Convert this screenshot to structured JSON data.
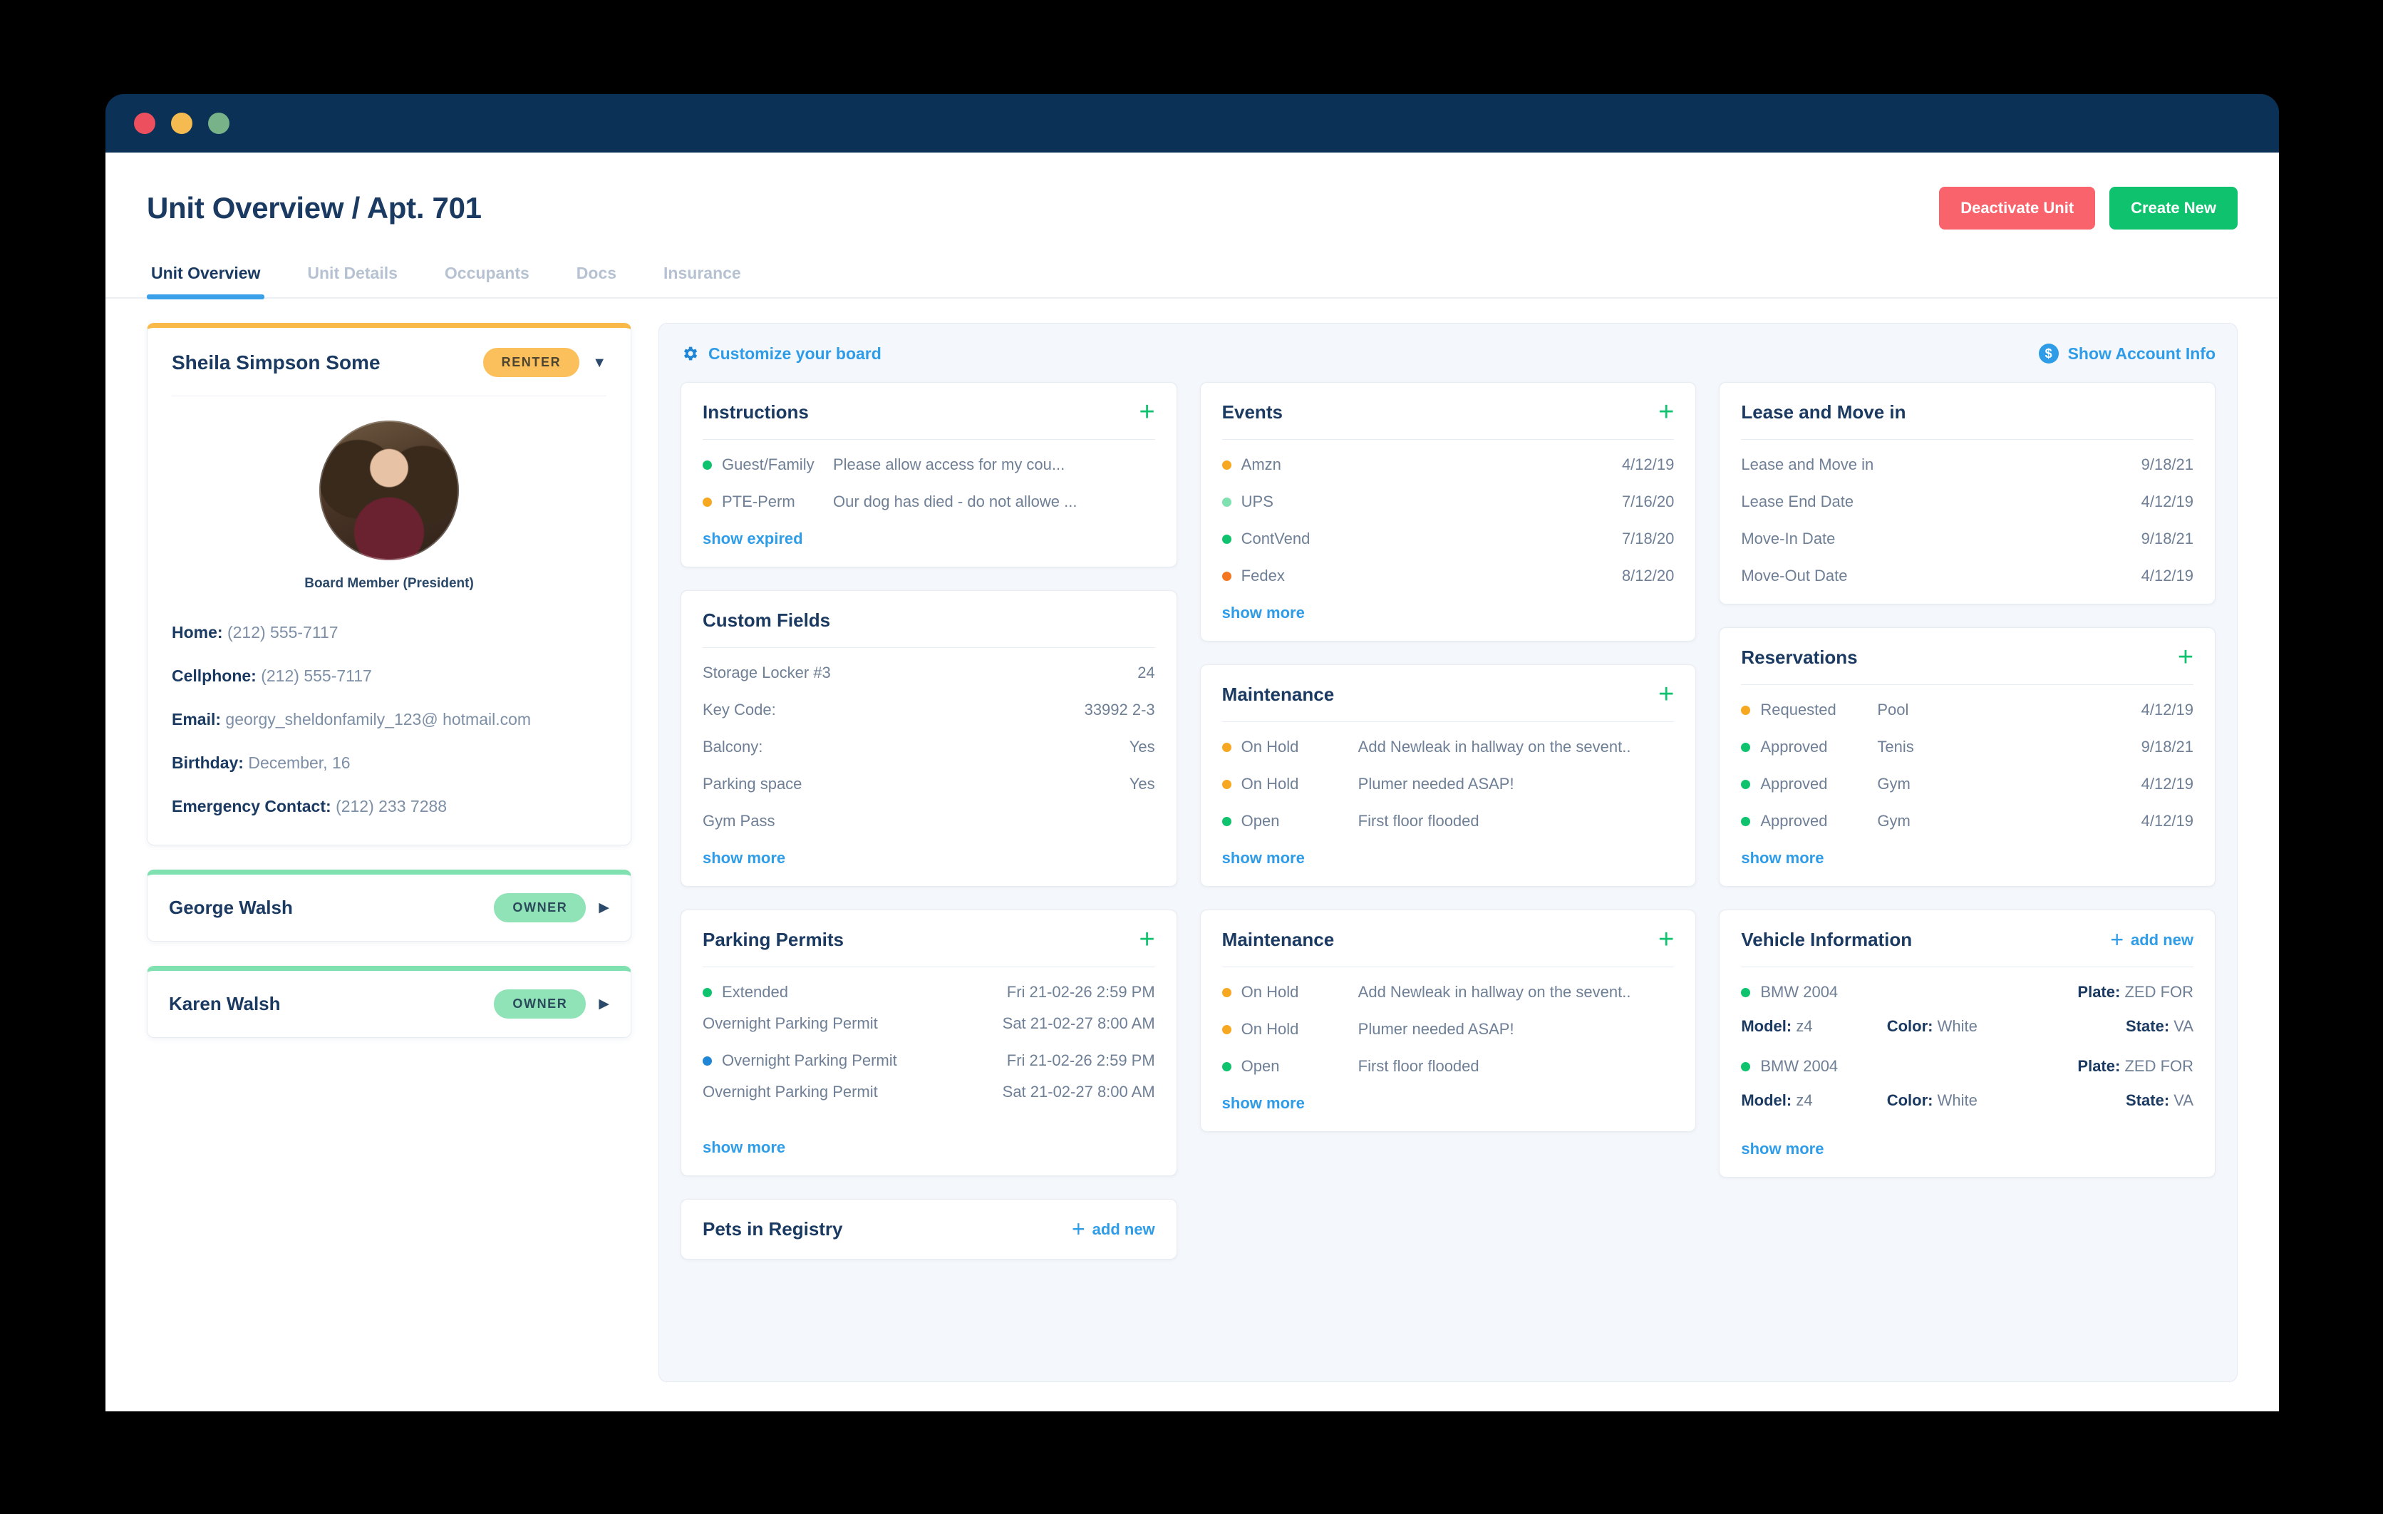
{
  "window": {
    "dots": [
      "close",
      "minimize",
      "zoom"
    ]
  },
  "header": {
    "title": "Unit Overview / Apt. 701",
    "deactivate_label": "Deactivate Unit",
    "create_label": "Create New"
  },
  "tabs": [
    {
      "label": "Unit Overview",
      "active": true
    },
    {
      "label": "Unit Details",
      "active": false
    },
    {
      "label": "Occupants",
      "active": false
    },
    {
      "label": "Docs",
      "active": false
    },
    {
      "label": "Insurance",
      "active": false
    }
  ],
  "people": [
    {
      "name": "Sheila Simpson Some",
      "badge": "RENTER",
      "role": "Board Member (President)",
      "contacts": [
        {
          "label": "Home:",
          "value": "(212) 555-7117"
        },
        {
          "label": "Cellphone:",
          "value": "(212) 555-7117"
        },
        {
          "label": "Email:",
          "value": "georgy_sheldonfamily_123@ hotmail.com"
        },
        {
          "label": "Birthday:",
          "value": "December, 16"
        },
        {
          "label": "Emergency Contact:",
          "value": "(212) 233 7288"
        }
      ]
    },
    {
      "name": "George Walsh",
      "badge": "OWNER"
    },
    {
      "name": "Karen Walsh",
      "badge": "OWNER"
    }
  ],
  "board": {
    "customize_label": "Customize your board",
    "account_info_label": "Show Account Info",
    "dollar_glyph": "$",
    "show_more_label": "show more",
    "show_expired_label": "show expired",
    "add_new_label": "add new",
    "plus_glyph": "+"
  },
  "cards": {
    "instructions": {
      "title": "Instructions",
      "rows": [
        {
          "dot": "green",
          "label": "Guest/Family",
          "desc": "Please allow access for my cou..."
        },
        {
          "dot": "orange",
          "label": "PTE-Perm",
          "desc": "Our dog has died - do not allowe ..."
        }
      ],
      "footer": "show expired"
    },
    "custom_fields": {
      "title": "Custom Fields",
      "rows": [
        {
          "label": "Storage Locker #3",
          "value": "24"
        },
        {
          "label": "Key Code:",
          "value": "33992 2-3"
        },
        {
          "label": "Balcony:",
          "value": "Yes"
        },
        {
          "label": "Parking space",
          "value": "Yes"
        },
        {
          "label": "Gym Pass",
          "value": ""
        }
      ],
      "footer": "show more"
    },
    "parking_permits": {
      "title": "Parking Permits",
      "entries": [
        {
          "dot": "green",
          "label": "Extended",
          "date": "Fri 21-02-26 2:59 PM",
          "sub_label": "Overnight Parking Permit",
          "sub_date": "Sat 21-02-27 8:00 AM"
        },
        {
          "dot": "blue",
          "label": "Overnight Parking Permit",
          "date": "Fri 21-02-26 2:59 PM",
          "sub_label": "Overnight Parking Permit",
          "sub_date": "Sat 21-02-27 8:00 AM"
        }
      ],
      "footer": "show more"
    },
    "pets": {
      "title": "Pets in Registry",
      "action": "add new"
    },
    "events": {
      "title": "Events",
      "rows": [
        {
          "dot": "orange",
          "label": "Amzn",
          "date": "4/12/19"
        },
        {
          "dot": "mint",
          "label": "UPS",
          "date": "7/16/20"
        },
        {
          "dot": "green",
          "label": "ContVend",
          "date": "7/18/20"
        },
        {
          "dot": "deepor",
          "label": "Fedex",
          "date": "8/12/20"
        }
      ],
      "footer": "show more"
    },
    "maintenance_1": {
      "title": "Maintenance",
      "rows": [
        {
          "dot": "orange",
          "label": "On Hold",
          "desc": "Add Newleak in hallway on the sevent.."
        },
        {
          "dot": "orange",
          "label": "On Hold",
          "desc": "Plumer needed ASAP!"
        },
        {
          "dot": "green",
          "label": "Open",
          "desc": "First floor flooded"
        }
      ],
      "footer": "show more"
    },
    "maintenance_2": {
      "title": "Maintenance",
      "rows": [
        {
          "dot": "orange",
          "label": "On Hold",
          "desc": "Add Newleak in hallway on the sevent.."
        },
        {
          "dot": "orange",
          "label": "On Hold",
          "desc": "Plumer needed ASAP!"
        },
        {
          "dot": "green",
          "label": "Open",
          "desc": "First floor flooded"
        }
      ],
      "footer": "show more"
    },
    "lease": {
      "title": "Lease and Move in",
      "rows": [
        {
          "label": "Lease and Move in",
          "value": "9/18/21"
        },
        {
          "label": "Lease End Date",
          "value": "4/12/19"
        },
        {
          "label": "Move-In Date",
          "value": "9/18/21"
        },
        {
          "label": "Move-Out Date",
          "value": "4/12/19"
        }
      ]
    },
    "reservations": {
      "title": "Reservations",
      "rows": [
        {
          "dot": "orange",
          "label": "Requested",
          "amenity": "Pool",
          "date": "4/12/19"
        },
        {
          "dot": "green",
          "label": "Approved",
          "amenity": "Tenis",
          "date": "9/18/21"
        },
        {
          "dot": "green",
          "label": "Approved",
          "amenity": "Gym",
          "date": "4/12/19"
        },
        {
          "dot": "green",
          "label": "Approved",
          "amenity": "Gym",
          "date": "4/12/19"
        }
      ],
      "footer": "show more"
    },
    "vehicles": {
      "title": "Vehicle Information",
      "action": "add new",
      "entries": [
        {
          "dot": "green",
          "name": "BMW 2004",
          "plate_key": "Plate:",
          "plate": "ZED FOR",
          "model_key": "Model:",
          "model": "z4",
          "color_key": "Color:",
          "color": "White",
          "state_key": "State:",
          "state": "VA"
        },
        {
          "dot": "green",
          "name": "BMW 2004",
          "plate_key": "Plate:",
          "plate": "ZED FOR",
          "model_key": "Model:",
          "model": "z4",
          "color_key": "Color:",
          "color": "White",
          "state_key": "State:",
          "state": "VA"
        }
      ],
      "footer": "show more"
    }
  },
  "colors": {
    "brand_navy": "#0b3156",
    "accent_blue": "#2f9ce8",
    "success_green": "#0fc36e",
    "danger_red": "#f8636c",
    "renter_yellow": "#fbc05b",
    "owner_green": "#8fe3b6"
  }
}
